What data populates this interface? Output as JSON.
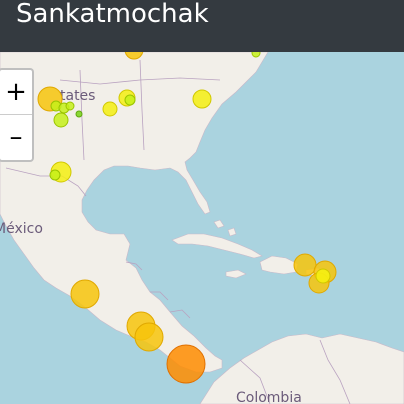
{
  "navbar": {
    "brand": "Sankatmochak"
  },
  "zoom": {
    "in_label": "+",
    "out_label": "–"
  },
  "map": {
    "labels": {
      "united_states_fragment": "tates",
      "mexico": "México",
      "colombia": "Colombia"
    },
    "colors": {
      "water": "#aad3df",
      "land": "#f2efe9",
      "green": "#7ed321",
      "yellow_green": "#c6f01a",
      "yellow": "#f5ef12",
      "gold": "#f7c40c",
      "orange": "#ff8c00"
    }
  }
}
